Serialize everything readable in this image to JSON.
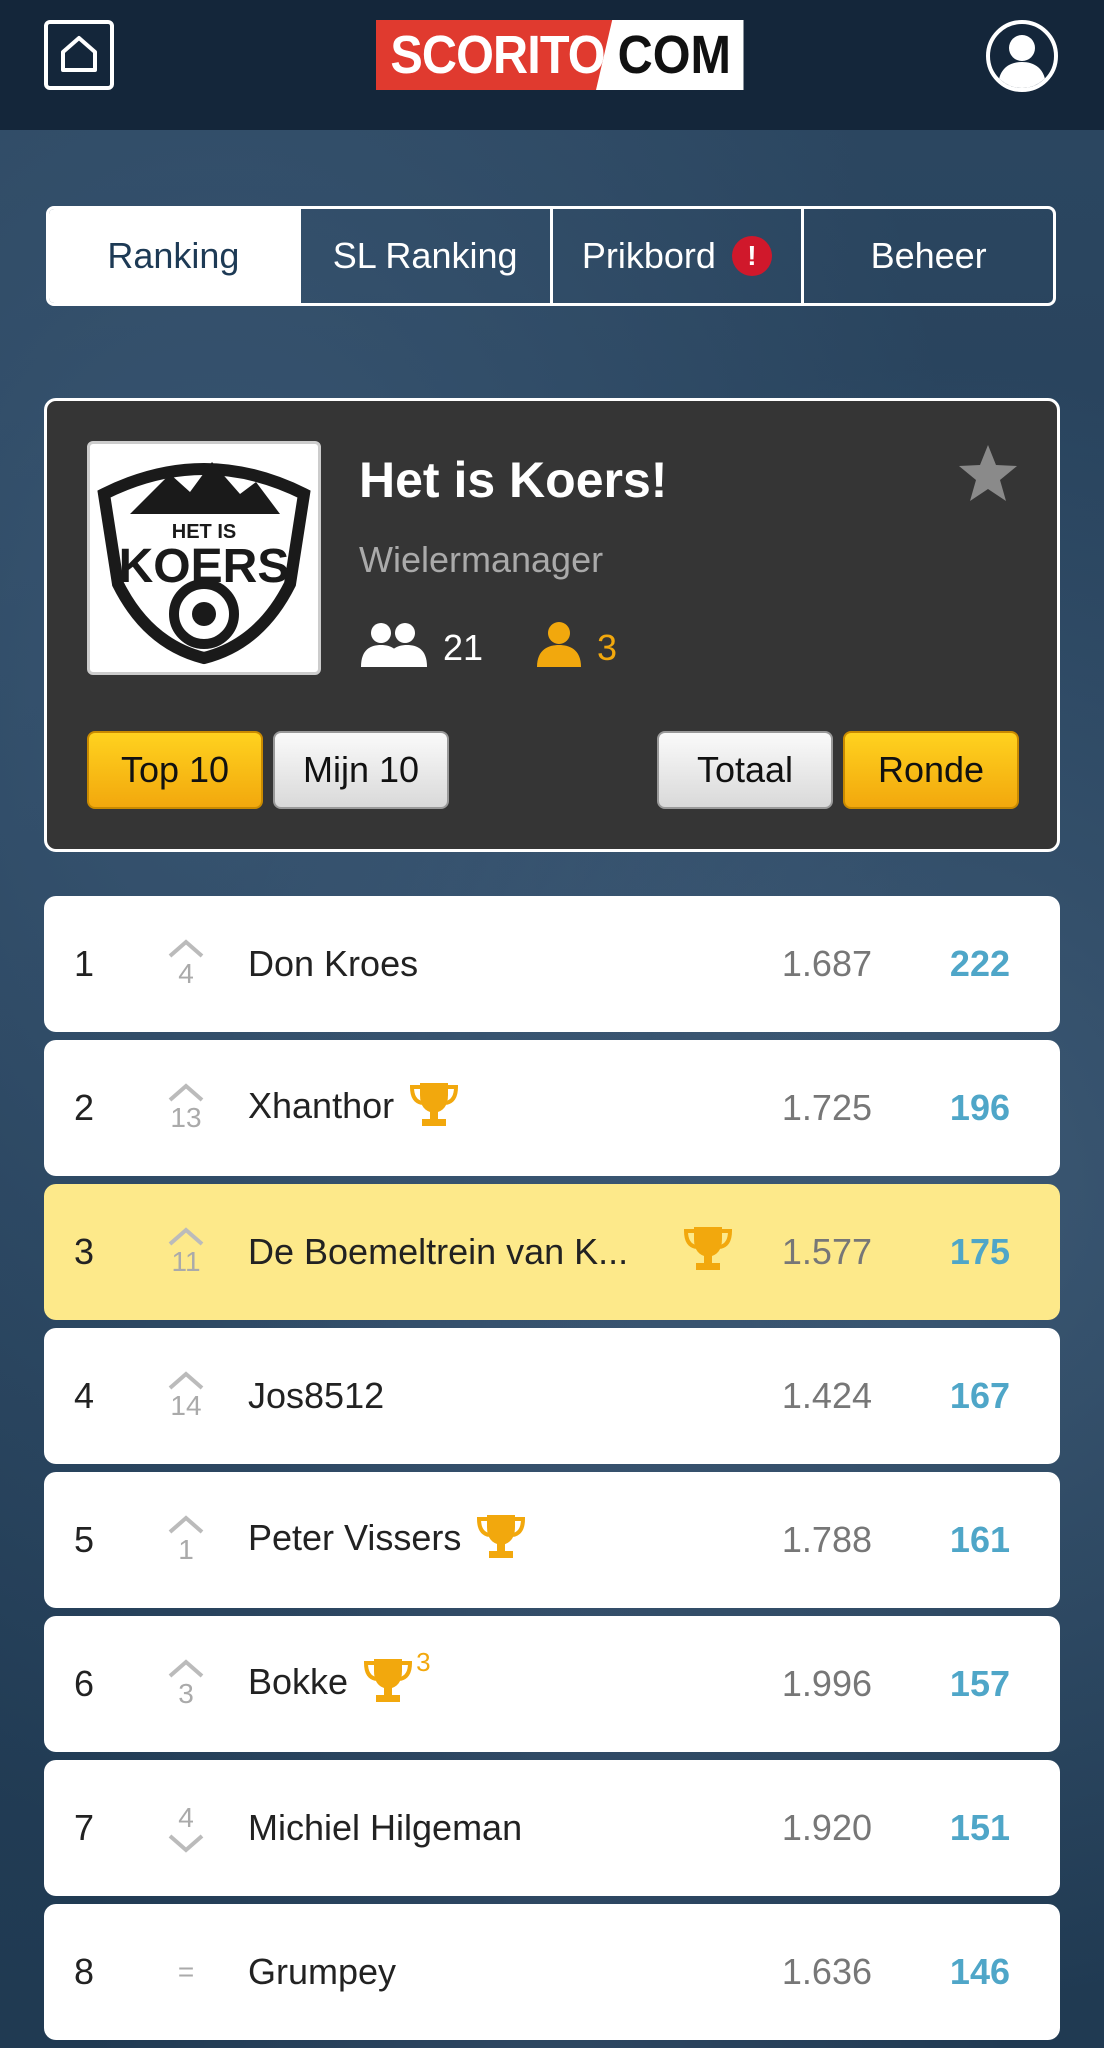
{
  "header": {
    "logo_left": "SCORITO",
    "logo_right": "COM",
    "home_icon": "home-icon",
    "account_icon": "user-avatar-icon"
  },
  "tabs": [
    {
      "label": "Ranking",
      "active": true
    },
    {
      "label": "SL Ranking",
      "active": false
    },
    {
      "label": "Prikbord",
      "active": false,
      "alert": "!"
    },
    {
      "label": "Beheer",
      "active": false
    }
  ],
  "league": {
    "badge_top": "HET IS",
    "badge_main": "KOERS",
    "title": "Het is Koers!",
    "subtitle": "Wielermanager",
    "members": "21",
    "admins": "3",
    "favorite_icon": "star-icon"
  },
  "filters": {
    "top10": "Top 10",
    "mine10": "Mijn 10",
    "total": "Totaal",
    "round": "Ronde"
  },
  "colors": {
    "accent_gold": "#f2a80d",
    "score_blue": "#4fa6c8",
    "highlight": "#fde98a",
    "brand_red": "#e03a2f"
  },
  "ranking": [
    {
      "rank": "1",
      "direction": "up",
      "change": "4",
      "name": "Don Kroes",
      "trophy": false,
      "trophy_count": "",
      "points": "1.687",
      "score": "222"
    },
    {
      "rank": "2",
      "direction": "up",
      "change": "13",
      "name": "Xhanthor",
      "trophy": true,
      "trophy_count": "",
      "points": "1.725",
      "score": "196"
    },
    {
      "rank": "3",
      "direction": "up",
      "change": "11",
      "name": "De Boemeltrein van K...",
      "trophy": true,
      "trophy_count": "",
      "points": "1.577",
      "score": "175",
      "highlight": true
    },
    {
      "rank": "4",
      "direction": "up",
      "change": "14",
      "name": "Jos8512",
      "trophy": false,
      "trophy_count": "",
      "points": "1.424",
      "score": "167"
    },
    {
      "rank": "5",
      "direction": "up",
      "change": "1",
      "name": "Peter Vissers",
      "trophy": true,
      "trophy_count": "",
      "points": "1.788",
      "score": "161"
    },
    {
      "rank": "6",
      "direction": "up",
      "change": "3",
      "name": "Bokke",
      "trophy": true,
      "trophy_count": "3",
      "points": "1.996",
      "score": "157"
    },
    {
      "rank": "7",
      "direction": "down",
      "change": "4",
      "name": "Michiel Hilgeman",
      "trophy": false,
      "trophy_count": "",
      "points": "1.920",
      "score": "151"
    },
    {
      "rank": "8",
      "direction": "same",
      "change": "=",
      "name": "Grumpey",
      "trophy": false,
      "trophy_count": "",
      "points": "1.636",
      "score": "146"
    }
  ]
}
